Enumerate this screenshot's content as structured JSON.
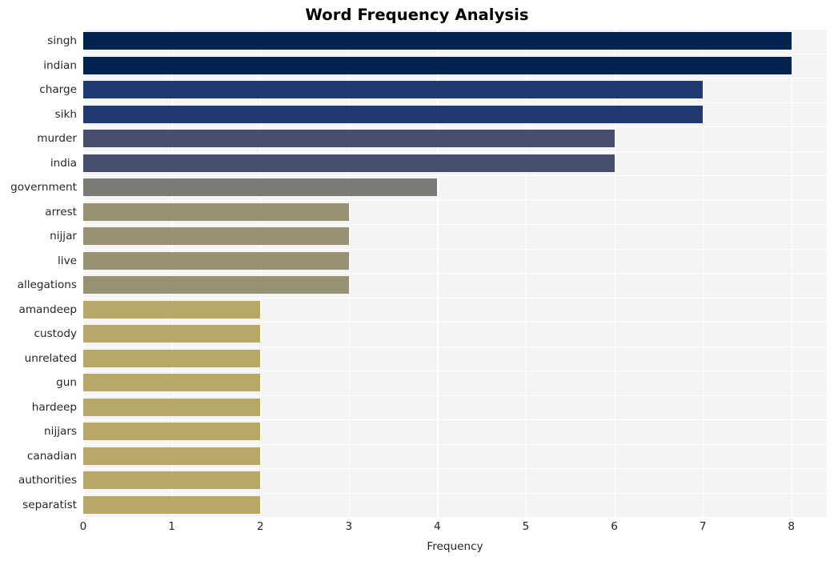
{
  "chart_data": {
    "type": "bar",
    "orientation": "horizontal",
    "title": "Word Frequency Analysis",
    "xlabel": "Frequency",
    "ylabel": "",
    "categories": [
      "singh",
      "indian",
      "charge",
      "sikh",
      "murder",
      "india",
      "government",
      "arrest",
      "nijjar",
      "live",
      "allegations",
      "amandeep",
      "custody",
      "unrelated",
      "gun",
      "hardeep",
      "nijjars",
      "canadian",
      "authorities",
      "separatist"
    ],
    "values": [
      8,
      8,
      7,
      7,
      6,
      6,
      4,
      3,
      3,
      3,
      3,
      2,
      2,
      2,
      2,
      2,
      2,
      2,
      2,
      2
    ],
    "bar_colors": [
      "#02244e",
      "#02244e",
      "#1e3a70",
      "#1e3a70",
      "#46506e",
      "#46506e",
      "#7c7a74",
      "#989172",
      "#989172",
      "#989172",
      "#989172",
      "#b8a868",
      "#b8a868",
      "#b8a868",
      "#b8a868",
      "#b8a868",
      "#b8a868",
      "#b8a868",
      "#b8a868",
      "#b8a868"
    ],
    "xlim": [
      0,
      8.4
    ],
    "xticks": [
      0,
      1,
      2,
      3,
      4,
      5,
      6,
      7,
      8
    ],
    "xtick_labels": [
      "0",
      "1",
      "2",
      "3",
      "4",
      "5",
      "6",
      "7",
      "8"
    ],
    "grid": true,
    "grid_color": "#ffffff",
    "plot_background": "#f4f4f5",
    "figure_background": "#ffffff",
    "legend": null
  }
}
